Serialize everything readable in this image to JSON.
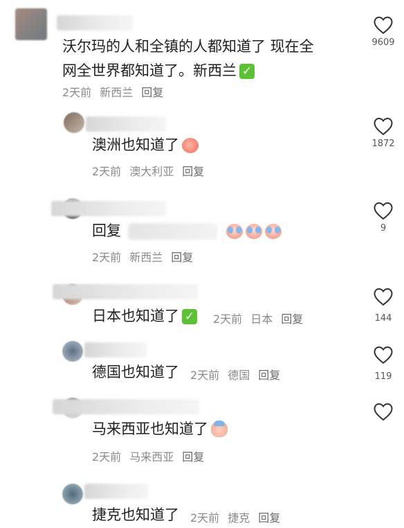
{
  "comments": [
    {
      "text_line1": "沃尔玛的人和全镇的人都知道了 现在全",
      "text_line2": "网全世界都知道了。新西兰",
      "time": "2天前",
      "location": "新西兰",
      "reply": "回复",
      "likes": "9609",
      "emoji": "check-mark"
    },
    {
      "text": "澳洲也知道了",
      "time": "2天前",
      "location": "澳大利亚",
      "reply": "回复",
      "likes": "1872",
      "emoji": "peach-face"
    },
    {
      "text": "回复",
      "time": "2天前",
      "location": "新西兰",
      "reply": "回复",
      "likes": "9",
      "emoji": "crying-faces"
    },
    {
      "text": "日本也知道了",
      "time": "2天前",
      "location": "日本",
      "reply": "回复",
      "likes": "144",
      "emoji": "check-mark"
    },
    {
      "text": "德国也知道了",
      "time": "2天前",
      "location": "德国",
      "reply": "回复",
      "likes": "119"
    },
    {
      "text": "马来西亚也知道了",
      "time": "2天前",
      "location": "马来西亚",
      "reply": "回复",
      "likes": "",
      "emoji": "sweating-face"
    },
    {
      "text": "捷克也知道了",
      "time": "2天前",
      "location": "捷克",
      "reply": "回复"
    }
  ],
  "check_glyph": "✓"
}
